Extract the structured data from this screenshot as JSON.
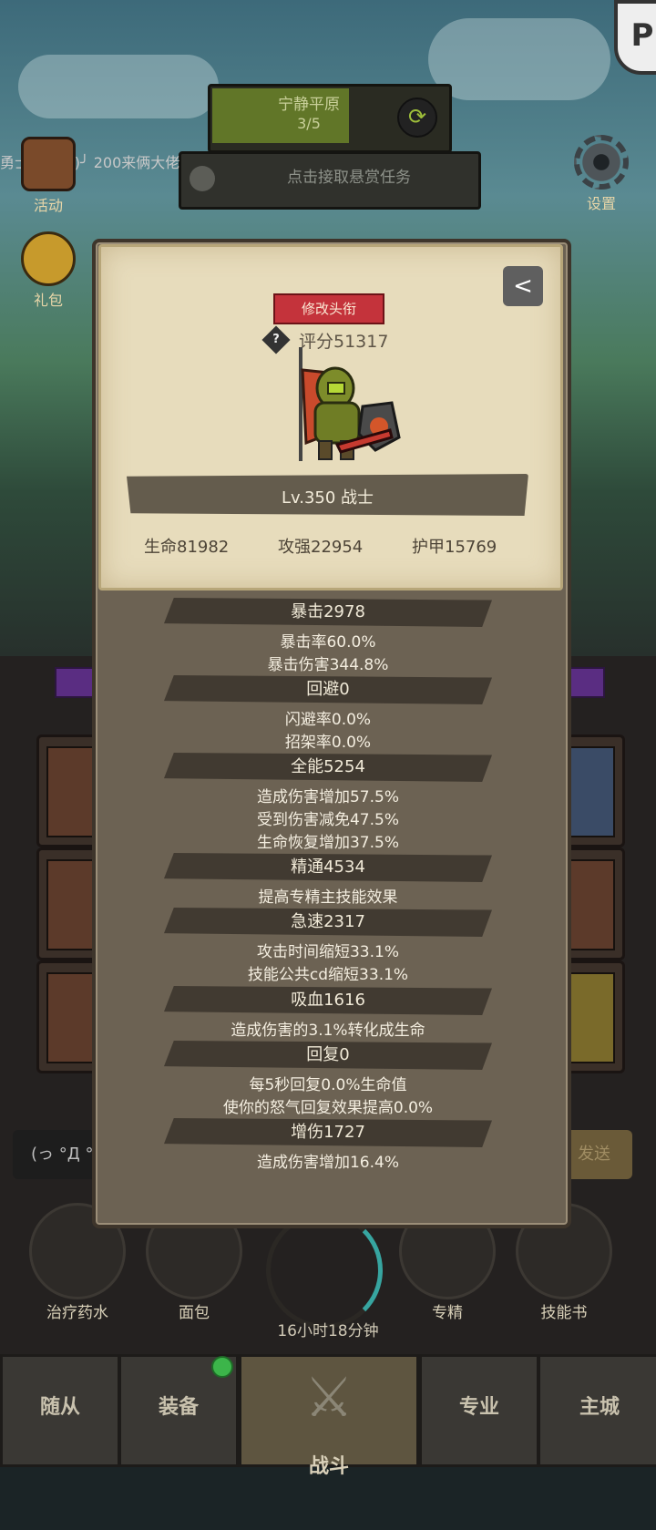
{
  "hud": {
    "region_name": "宁静平原",
    "region_progress": "3/5",
    "region_progress_value": 0.6,
    "bounty_label": "点击接取悬赏任务",
    "chat_line": "勇士:(╯°Д°)╯ 200来俩大佬",
    "side_buttons": [
      {
        "label": "活动",
        "icon": "event-icon"
      },
      {
        "label": "礼包",
        "icon": "giftpack-icon"
      }
    ],
    "settings_label": "设置",
    "logo_glyph": "P"
  },
  "profile": {
    "edit_title_label": "修改头衔",
    "score": "评分51317",
    "level_line": "Lv.350 战士",
    "hp": "生命81982",
    "attack": "攻强22954",
    "armor": "护甲15769",
    "share_icon": "share-icon"
  },
  "stats": [
    {
      "header": "暴击2978",
      "lines": [
        "暴击率60.0%",
        "暴击伤害344.8%"
      ]
    },
    {
      "header": "回避0",
      "lines": [
        "闪避率0.0%",
        "招架率0.0%"
      ]
    },
    {
      "header": "全能5254",
      "lines": [
        "造成伤害增加57.5%",
        "受到伤害减免47.5%",
        "生命恢复增加37.5%"
      ]
    },
    {
      "header": "精通4534",
      "lines": [
        "提高专精主技能效果"
      ]
    },
    {
      "header": "急速2317",
      "lines": [
        "攻击时间缩短33.1%",
        "技能公共cd缩短33.1%"
      ]
    },
    {
      "header": "吸血1616",
      "lines": [
        "造成伤害的3.1%转化成生命"
      ]
    },
    {
      "header": "回复0",
      "lines": [
        "每5秒回复0.0%生命值",
        "使你的怒气回复效果提高0.0%"
      ]
    },
    {
      "header": "增伤1727",
      "lines": [
        "造成伤害增加16.4%"
      ]
    }
  ],
  "bottom": {
    "chat_input": "(っ °Д °",
    "send_label": "发送",
    "items": [
      "治疗药水",
      "面包",
      "专精",
      "技能书"
    ],
    "chest_timer": "16小时18分钟",
    "nav": [
      "随从",
      "装备",
      "战斗",
      "专业",
      "主城"
    ]
  },
  "colors": {
    "title_button": "#c4333b",
    "progress_fill": "#6f8a2a",
    "panel_bg": "#6c6253",
    "card_bg": "#e7dcbc"
  }
}
